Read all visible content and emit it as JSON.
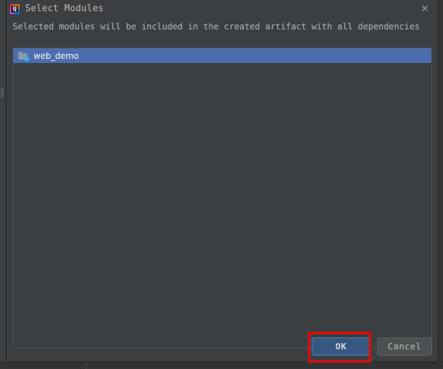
{
  "window": {
    "title": "Select Modules",
    "app_icon": "intellij-idea-icon",
    "close_icon": "✕"
  },
  "dialog": {
    "description": "Selected modules will be included in the created artifact with all dependencies"
  },
  "modules_list": {
    "items": [
      {
        "label": "web_demo",
        "icon": "module-folder-icon",
        "selected": true
      }
    ]
  },
  "footer": {
    "ok_label": "OK",
    "cancel_label": "Cancel"
  },
  "colors": {
    "dialog_background": "#3c3f41",
    "selection_blue": "#4b6eaf",
    "ok_button_fill": "#365880",
    "ok_button_border": "#4a82c4",
    "cancel_button_fill": "#4c5052",
    "text_primary": "#a9b7c6",
    "title_text": "#bbbbbb",
    "annotation_red": "#ff0000",
    "module_icon_folder": "#8d9aa8",
    "module_icon_badge": "#40b6e0"
  }
}
